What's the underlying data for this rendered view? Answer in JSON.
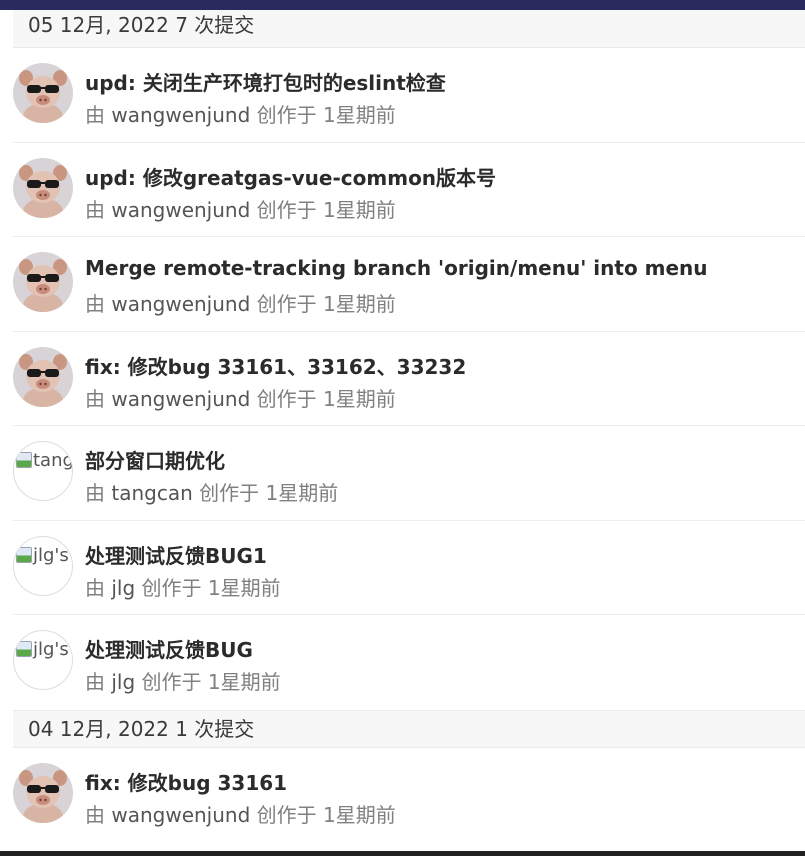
{
  "groups": [
    {
      "header": "05 12月, 2022 7 次提交",
      "commits": [
        {
          "title": "upd: 关闭生产环境打包时的eslint检查",
          "by": "由",
          "author": "wangwenjund",
          "created": "创作于",
          "time": "1星期前",
          "avatar": "pig"
        },
        {
          "title": "upd: 修改greatgas-vue-common版本号",
          "by": "由",
          "author": "wangwenjund",
          "created": "创作于",
          "time": "1星期前",
          "avatar": "pig"
        },
        {
          "title": "Merge remote-tracking branch 'origin/menu' into menu",
          "by": "由",
          "author": "wangwenjund",
          "created": "创作于",
          "time": "1星期前",
          "avatar": "pig"
        },
        {
          "title": "fix: 修改bug 33161、33162、33232",
          "by": "由",
          "author": "wangwenjund",
          "created": "创作于",
          "time": "1星期前",
          "avatar": "pig"
        },
        {
          "title": "部分窗口期优化",
          "by": "由",
          "author": "tangcan",
          "created": "创作于",
          "time": "1星期前",
          "avatar_alt": "tang"
        },
        {
          "title": "处理测试反馈BUG1",
          "by": "由",
          "author": "jlg",
          "created": "创作于",
          "time": "1星期前",
          "avatar_alt": "jlg's"
        },
        {
          "title": "处理测试反馈BUG",
          "by": "由",
          "author": "jlg",
          "created": "创作于",
          "time": "1星期前",
          "avatar_alt": "jlg's"
        }
      ]
    },
    {
      "header": "04 12月, 2022 1 次提交",
      "commits": [
        {
          "title": "fix: 修改bug 33161",
          "by": "由",
          "author": "wangwenjund",
          "created": "创作于",
          "time": "1星期前",
          "avatar": "pig"
        }
      ]
    }
  ],
  "colors": {
    "topbar": "#2a2a5e",
    "header_bg": "#f7f7f8",
    "meta": "#808080"
  }
}
